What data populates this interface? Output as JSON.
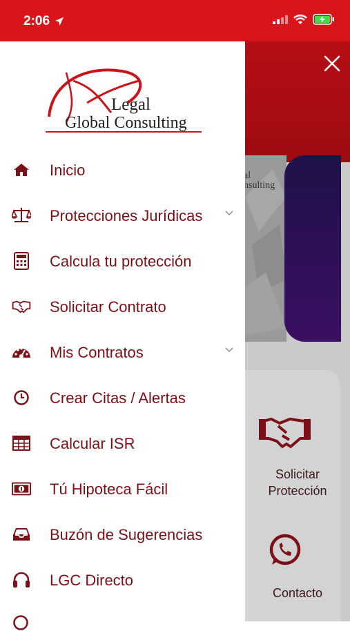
{
  "status_bar": {
    "time": "2:06"
  },
  "logo": {
    "line1": "Legal",
    "line2": "Global Consulting"
  },
  "menu": {
    "items": [
      {
        "label": "Inicio",
        "icon": "home-icon",
        "has_submenu": false
      },
      {
        "label": "Protecciones Jurídicas",
        "icon": "scale-icon",
        "has_submenu": true
      },
      {
        "label": "Calcula tu protección",
        "icon": "calculator-icon",
        "has_submenu": false
      },
      {
        "label": "Solicitar Contrato",
        "icon": "handshake-icon",
        "has_submenu": false
      },
      {
        "label": "Mis Contratos",
        "icon": "gauge-icon",
        "has_submenu": true
      },
      {
        "label": "Crear Citas / Alertas",
        "icon": "clock-icon",
        "has_submenu": false
      },
      {
        "label": "Calcular ISR",
        "icon": "table-icon",
        "has_submenu": false
      },
      {
        "label": "Tú Hipoteca Fácil",
        "icon": "money-icon",
        "has_submenu": false
      },
      {
        "label": "Buzón de Sugerencias",
        "icon": "inbox-icon",
        "has_submenu": false
      },
      {
        "label": "LGC Directo",
        "icon": "headphones-icon",
        "has_submenu": false
      }
    ]
  },
  "background": {
    "banner_logo_line1": "al",
    "banner_logo_line2": "nsulting",
    "card_solicitar": "Solicitar",
    "card_proteccion": "Protección",
    "card_contacto": "Contacto"
  },
  "colors": {
    "brand_red": "#d9151c",
    "menu_text": "#7b1118",
    "icon": "#7b1118"
  }
}
